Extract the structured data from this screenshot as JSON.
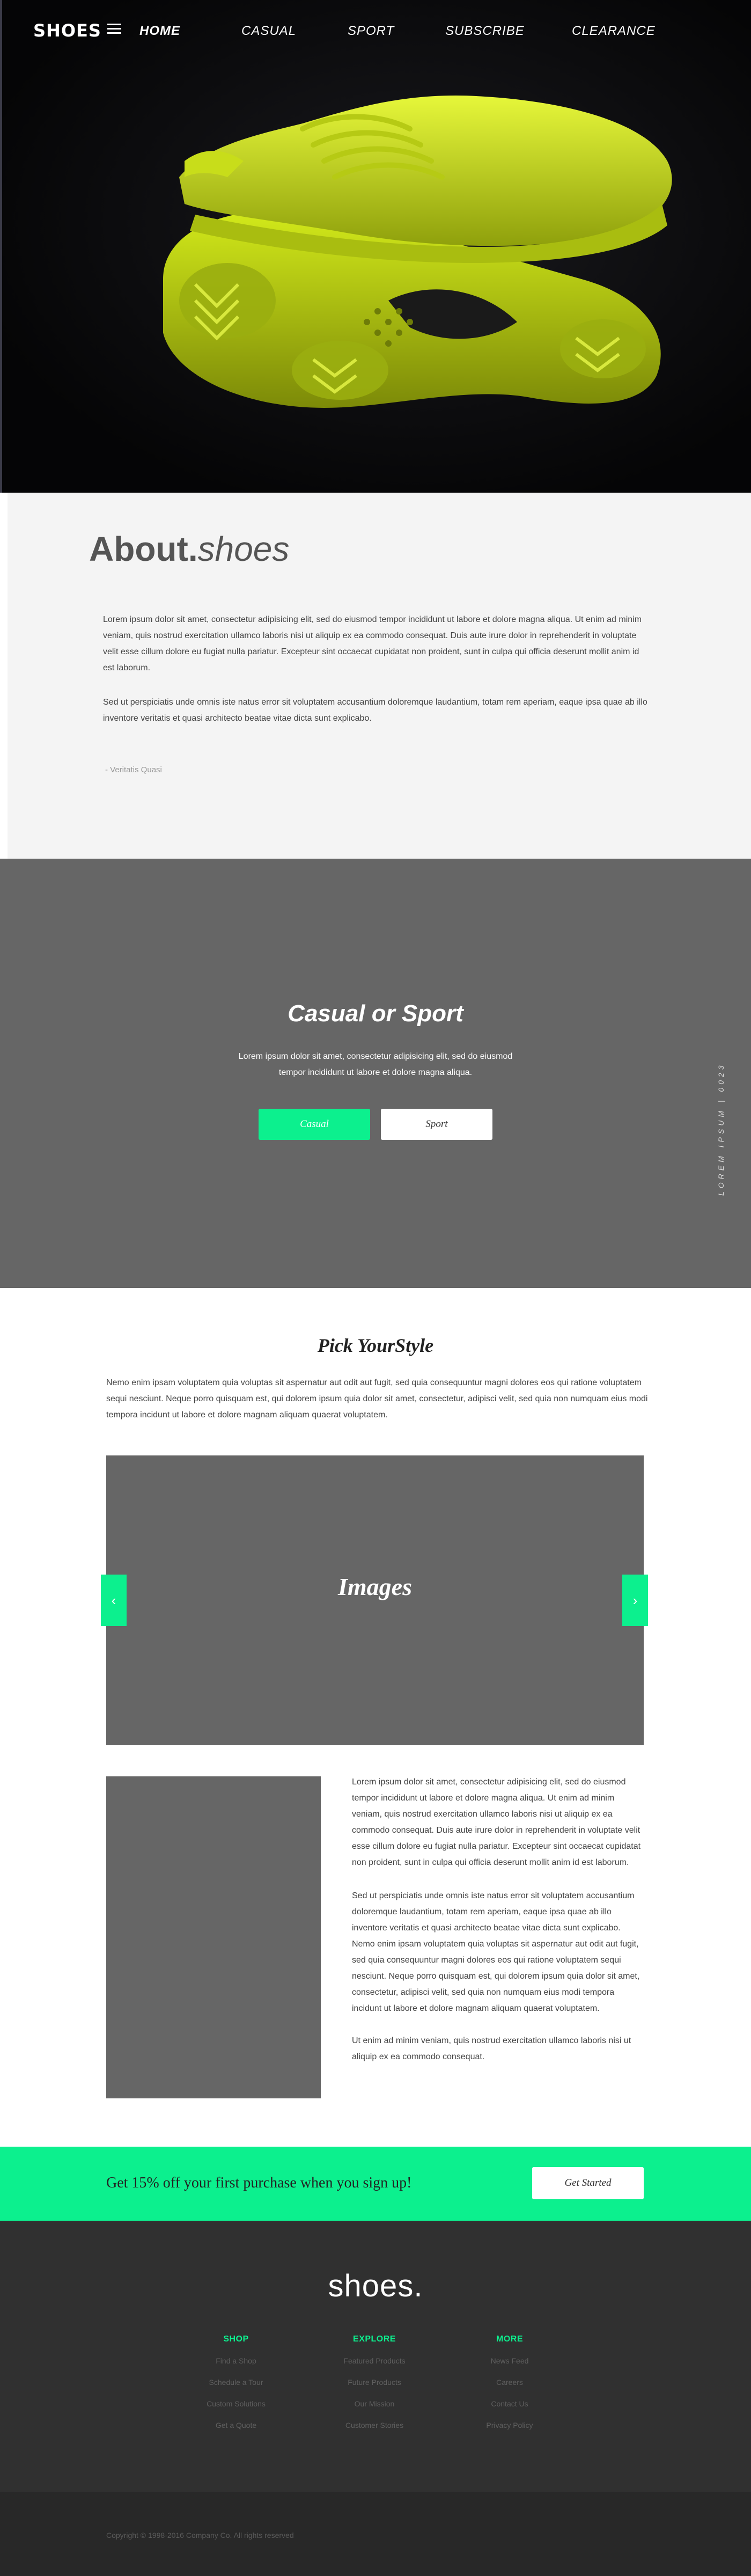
{
  "header": {
    "brand": "SHOES",
    "nav": [
      {
        "label": "HOME",
        "active": true
      },
      {
        "label": "CASUAL",
        "active": false
      },
      {
        "label": "SPORT",
        "active": false
      },
      {
        "label": "SUBSCRIBE",
        "active": false
      },
      {
        "label": "CLEARANCE",
        "active": false
      }
    ]
  },
  "about": {
    "title_bold": "About.",
    "title_italic": "shoes",
    "paragraph1": "Lorem ipsum dolor sit amet, consectetur adipisicing elit, sed do eiusmod tempor incididunt ut labore et dolore magna aliqua. Ut enim ad minim veniam, quis nostrud exercitation ullamco laboris nisi ut aliquip ex ea commodo consequat. Duis aute irure dolor in reprehenderit in voluptate velit esse cillum dolore eu fugiat nulla pariatur. Excepteur sint occaecat cupidatat non proident, sunt in culpa qui officia deserunt mollit anim id est laborum.",
    "paragraph2": "Sed ut perspiciatis unde omnis iste natus error sit voluptatem accusantium doloremque laudantium, totam rem aperiam, eaque ipsa quae ab illo inventore veritatis et quasi architecto beatae vitae dicta sunt explicabo.",
    "quote": "- Veritatis Quasi"
  },
  "casual_sport": {
    "title": "Casual or Sport",
    "text": "Lorem ipsum dolor sit amet, consectetur adipisicing elit, sed do eiusmod tempor incididunt ut labore et dolore magna aliqua.",
    "casual_button": "Casual",
    "sport_button": "Sport",
    "side_label": "LOREM IPSUM | 0023"
  },
  "pick_style": {
    "title": "Pick YourStyle",
    "text": "Nemo enim ipsam voluptatem quia voluptas sit aspernatur aut odit aut fugit, sed quia consequuntur magni dolores eos qui ratione voluptatem sequi nesciunt. Neque porro quisquam est, qui dolorem ipsum quia dolor sit amet, consectetur, adipisci velit, sed quia non numquam eius modi tempora incidunt ut labore et dolore magnam aliquam quaerat voluptatem.",
    "carousel_label": "Images",
    "prev_arrow": "‹",
    "next_arrow": "›",
    "detail_p1": "Lorem ipsum dolor sit amet, consectetur adipisicing elit, sed do eiusmod tempor incididunt ut labore et dolore magna aliqua. Ut enim ad minim veniam, quis nostrud exercitation ullamco laboris nisi ut aliquip ex ea commodo consequat. Duis aute irure dolor in reprehenderit in voluptate velit esse cillum dolore eu fugiat nulla pariatur. Excepteur sint occaecat cupidatat non proident, sunt in culpa qui officia deserunt mollit anim id est laborum.",
    "detail_p2": "Sed ut perspiciatis unde omnis iste natus error sit voluptatem accusantium doloremque laudantium, totam rem aperiam, eaque ipsa quae ab illo inventore veritatis et quasi architecto beatae vitae dicta sunt explicabo. Nemo enim ipsam voluptatem quia voluptas sit aspernatur aut odit aut fugit, sed quia consequuntur magni dolores eos qui ratione voluptatem sequi nesciunt. Neque porro quisquam est, qui dolorem ipsum quia dolor sit amet, consectetur, adipisci velit, sed quia non numquam eius modi tempora incidunt ut labore et dolore magnam aliquam quaerat voluptatem.",
    "detail_p3": "Ut enim ad minim veniam, quis nostrud exercitation ullamco laboris nisi ut aliquip ex ea commodo consequat."
  },
  "promo": {
    "text": "Get 15% off your first purchase when you sign up!",
    "button": "Get Started"
  },
  "footer": {
    "logo": "shoes.",
    "columns": [
      {
        "heading": "SHOP",
        "links": [
          "Find a Shop",
          "Schedule a Tour",
          "Custom Solutions",
          "Get a Quote"
        ]
      },
      {
        "heading": "EXPLORE",
        "links": [
          "Featured Products",
          "Future Products",
          "Our Mission",
          "Customer Stories"
        ]
      },
      {
        "heading": "MORE",
        "links": [
          "News Feed",
          "Careers",
          "Contact Us",
          "Privacy Policy"
        ]
      }
    ],
    "copyright": "Copyright © 1998-2016 Company Co. All rights reserved"
  },
  "colors": {
    "accent": "#0cf08e",
    "gray_panel": "#666666",
    "footer_bg": "#303030",
    "hero_bg": "#060607",
    "shoe": "#d7ef1e"
  }
}
